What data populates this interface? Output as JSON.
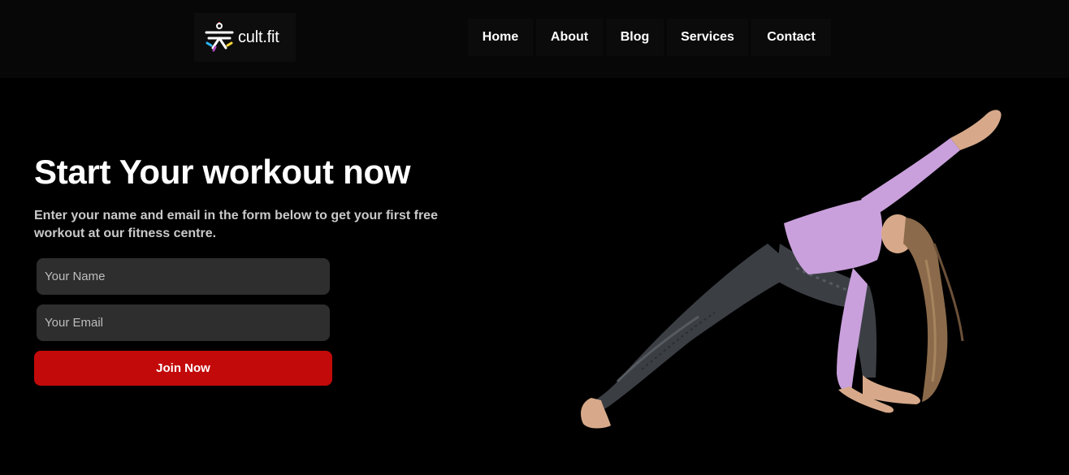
{
  "header": {
    "logo_text": "cult.fit",
    "nav": [
      {
        "label": "Home"
      },
      {
        "label": "About"
      },
      {
        "label": "Blog"
      },
      {
        "label": "Services"
      },
      {
        "label": "Contact"
      }
    ]
  },
  "hero": {
    "title": "Start Your workout now",
    "description": "Enter your name and email in the form below to get your first free workout at our fitness centre.",
    "name_placeholder": "Your Name",
    "email_placeholder": "Your Email",
    "join_label": "Join Now",
    "accent_color": "#c30a0a"
  },
  "icons": {
    "logo": "cult-fit-logo-icon"
  }
}
